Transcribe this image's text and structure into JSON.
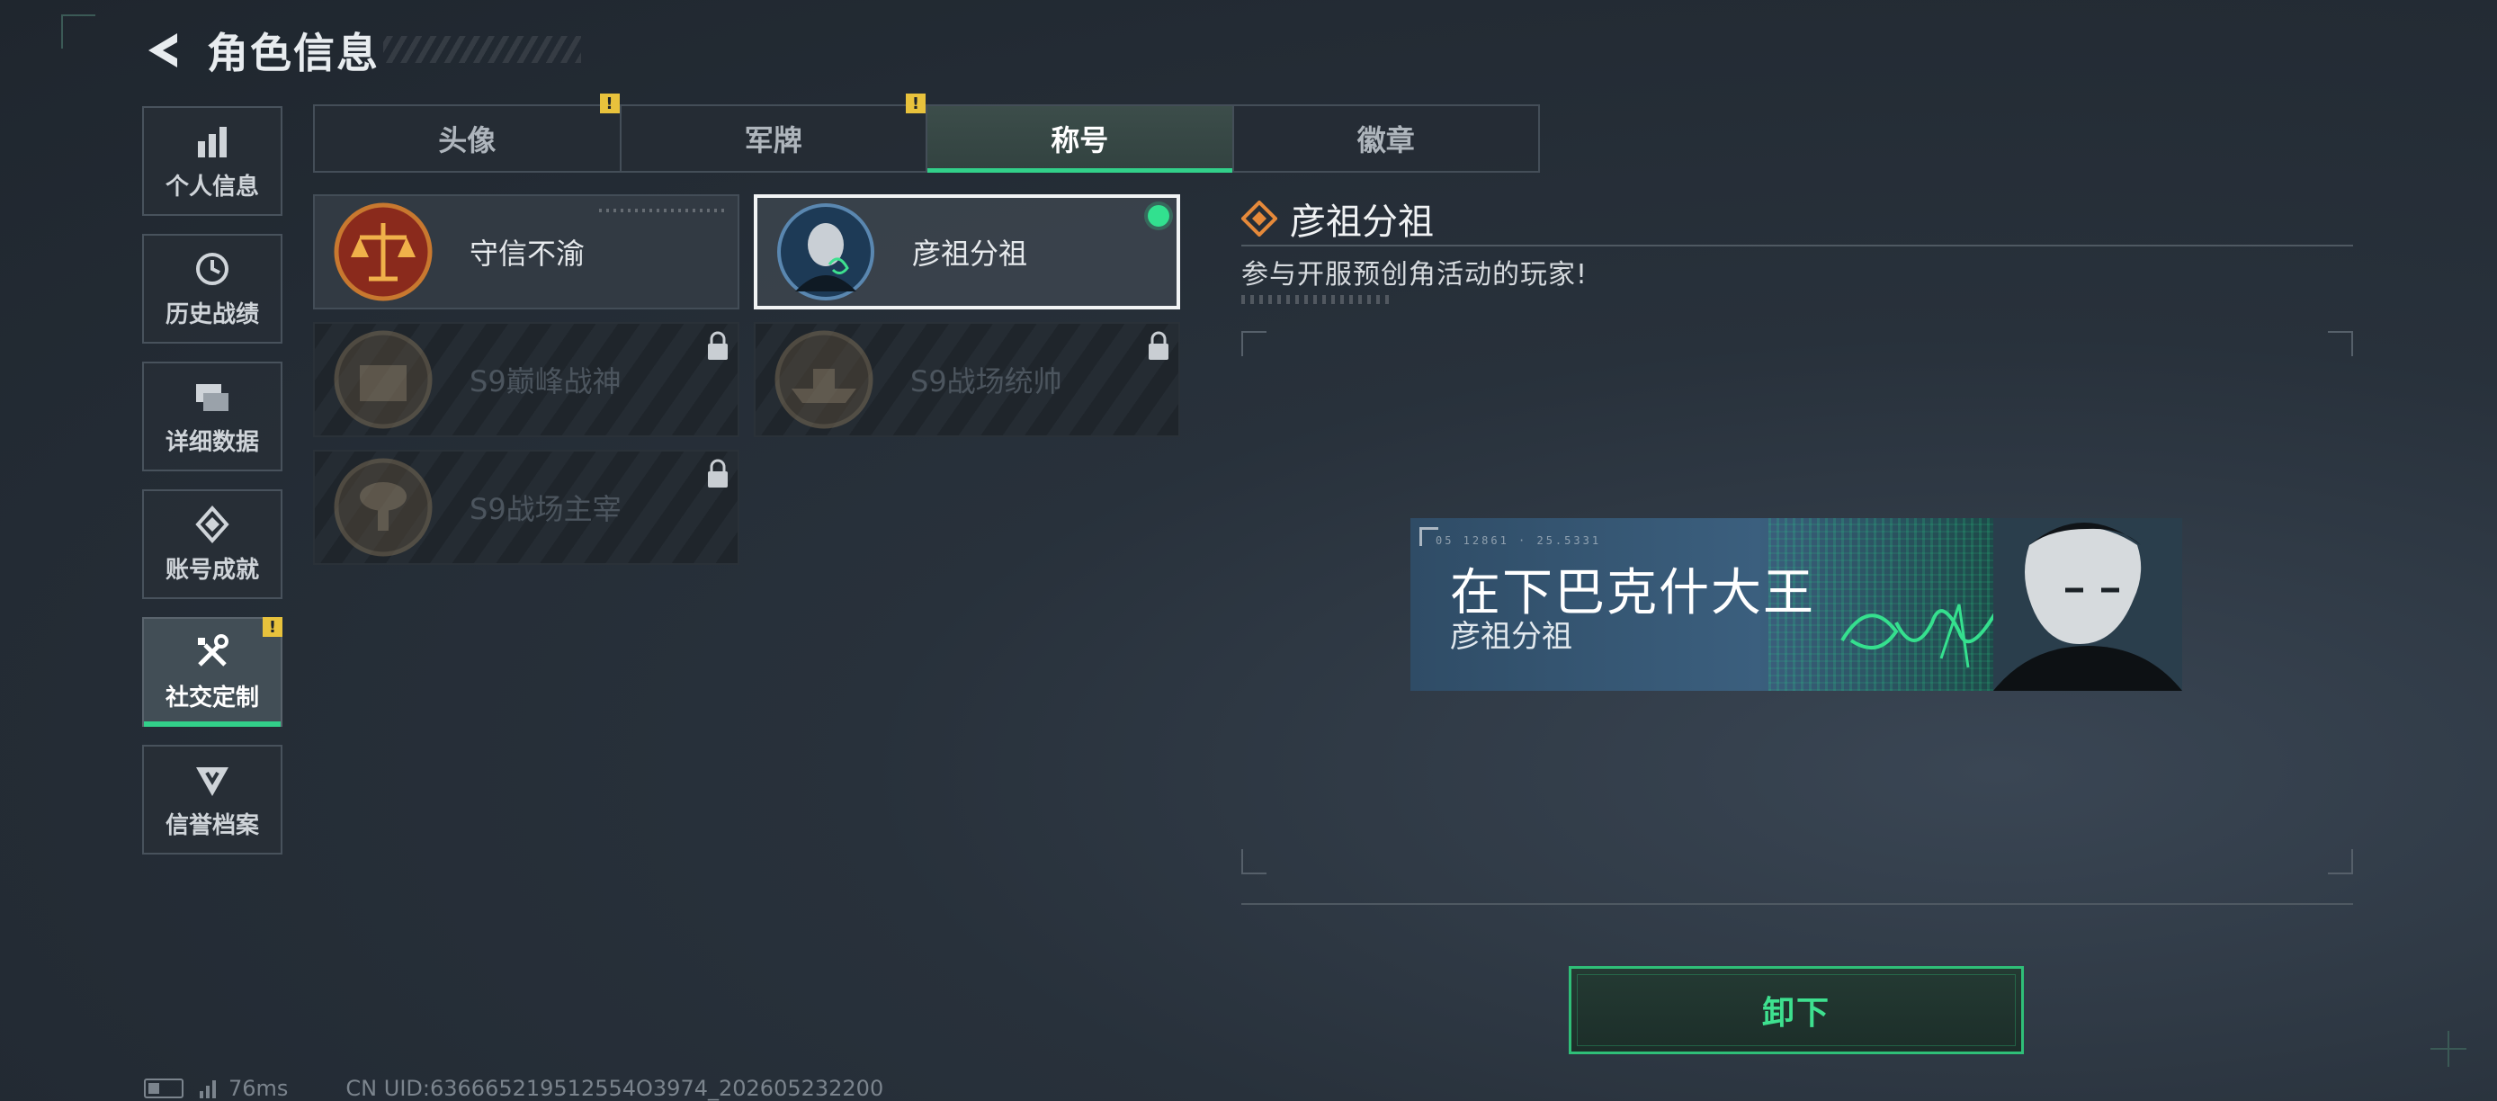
{
  "header": {
    "title": "角色信息",
    "back_icon": "back-arrow-icon"
  },
  "sidebar": {
    "items": [
      {
        "label": "个人信息",
        "icon": "bar-chart-icon",
        "active": false
      },
      {
        "label": "历史战绩",
        "icon": "history-clock-icon",
        "active": false
      },
      {
        "label": "详细数据",
        "icon": "folder-icon",
        "active": false
      },
      {
        "label": "账号成就",
        "icon": "achievement-diamond-icon",
        "active": false
      },
      {
        "label": "社交定制",
        "icon": "tools-icon",
        "active": true,
        "badge": "!"
      },
      {
        "label": "信誉档案",
        "icon": "reputation-shield-icon",
        "active": false
      }
    ]
  },
  "tabs": [
    {
      "label": "头像",
      "badge": "!"
    },
    {
      "label": "军牌",
      "badge": "!"
    },
    {
      "label": "称号",
      "active": true
    },
    {
      "label": "徽章"
    }
  ],
  "titles": [
    {
      "label": "守信不渝",
      "state": "unlocked",
      "emblem": "scales-emblem-icon"
    },
    {
      "label": "彦祖分祖",
      "state": "equipped",
      "emblem": "portrait-emblem-icon"
    },
    {
      "label": "S9巅峰战神",
      "state": "locked",
      "emblem": "building-emblem-icon"
    },
    {
      "label": "S9战场统帅",
      "state": "locked",
      "emblem": "ship-emblem-icon"
    },
    {
      "label": "S9战场主宰",
      "state": "locked",
      "emblem": "mushroom-cloud-emblem-icon"
    }
  ],
  "detail": {
    "title": "彦祖分祖",
    "description": "参与开服预创角活动的玩家!",
    "banner": {
      "main_text": "在下巴克什大王",
      "sub_text": "彦祖分祖",
      "tick_text": "05 12861 · 25.5331"
    },
    "action_label": "卸下"
  },
  "status": {
    "ping": "76ms",
    "uid": "CN UID:636665219512554O3974_202605232200"
  },
  "colors": {
    "accent": "#32d08a",
    "badge": "#e8c23c",
    "background": "#242c34"
  }
}
